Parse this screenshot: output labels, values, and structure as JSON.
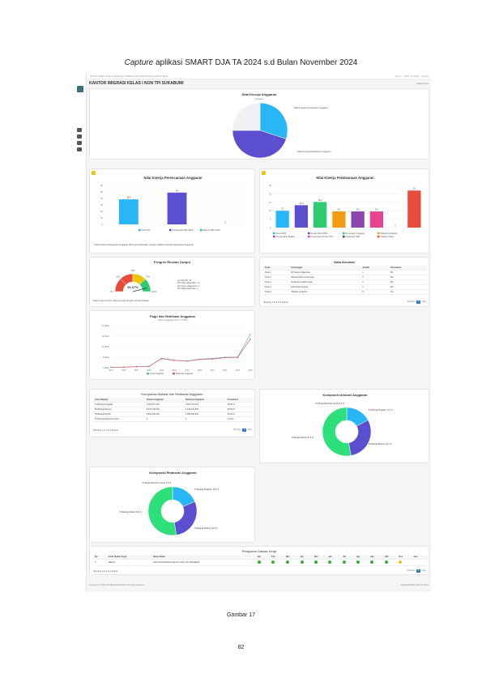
{
  "caption_top": {
    "italic": "Capture",
    "rest": " aplikasi SMART DJA TA 2024 s.d Bulan November 2024"
  },
  "caption_bottom": "Gambar 17",
  "page_number": "82",
  "app": {
    "topbar_title": "MONITORING DAN EVALUASI KINERJA PELAKSANAAN ANGGARAN",
    "topbar_right": [
      "Home",
      "TWIT TA 2024",
      "Logout"
    ],
    "office": "KANTOR IMIGRASI KELAS I NON TPI SUKABUMI",
    "breadcrumb": "Dashboard",
    "footer_left": "Copyright © 2024 DITJEN ANGGARAN. All rights reserved.",
    "footer_right": "Aplikasi SMART DJA TA 2024"
  },
  "nka_pie": {
    "title": "Nilai Kinerja Anggaran",
    "sub": "Capaian",
    "label_a": "Nilai Kinerja Perencanaan Anggaran",
    "label_b": "Nilai Kinerja Pelaksanaan Anggaran"
  },
  "chart_data": [
    {
      "type": "pie",
      "title": "Nilai Kinerja Anggaran",
      "slices": [
        {
          "name": "Nilai Kinerja Perencanaan Anggaran",
          "value": 30,
          "color": "#29b6f6"
        },
        {
          "name": "Nilai Kinerja Pelaksanaan Anggaran",
          "value": 45,
          "color": "#5b4fd0"
        },
        {
          "name": "",
          "value": 25,
          "color": "#f1f1f3"
        }
      ]
    },
    {
      "type": "bar",
      "title": "Nilai Kinerja Perencanaan Anggaran",
      "categories": [
        "IKPA",
        "Penggunaan",
        "Efisiensi"
      ],
      "values": [
        38.6,
        49,
        0
      ],
      "ylim": [
        0,
        60
      ],
      "colors": [
        "#29b6f6",
        "#5b4fd0",
        "#2ecc71"
      ],
      "labels": [
        "38.6",
        "49",
        "0"
      ],
      "legend": [
        "Nilai IKPA",
        "Penggunaan SBK (35%)",
        "Efisiensi SBK (25%)"
      ]
    },
    {
      "type": "bar",
      "title": "Nilai Kinerja Pelaksanaan Anggaran",
      "categories": [
        "a",
        "b",
        "c",
        "d",
        "e",
        "f",
        "g",
        "h"
      ],
      "values": [
        10,
        13.3,
        15.2,
        9.6,
        9.6,
        9.6,
        0,
        22
      ],
      "ylim": [
        0,
        25
      ],
      "colors": [
        "#29b6f6",
        "#5b4fd0",
        "#2ecc71",
        "#f39c12",
        "#8e44ad",
        "#e84393",
        "#34495e",
        "#e74c3c"
      ],
      "labels": [
        "10",
        "13.3",
        "15.2",
        "9.6",
        "9.6",
        "9.6",
        "0",
        "22"
      ],
      "legend": [
        "Revisi DIPA",
        "Deviasi Hal III DIPA",
        "Penyerapan Anggaran",
        "Belanja Kontraktual",
        "Penyelesaian Tagihan",
        "Pengelolaan UP dan TUP",
        "Dispensasi SPM",
        "Capaian Output"
      ]
    },
    {
      "type": "line",
      "title": "Pagu dan Realisasi Anggaran",
      "sub": "Tahun Anggaran 2017 s.d 2024",
      "x": [
        "2013",
        "2014",
        "2015",
        "2016",
        "2017",
        "2018",
        "2019",
        "2020",
        "2021",
        "2022",
        "2023",
        "2024"
      ],
      "series": [
        {
          "name": "Pagu Anggaran",
          "values": [
            0.2,
            0.3,
            0.5,
            0.6,
            4.5,
            3.6,
            3.2,
            4.1,
            4.4,
            5.0,
            5.1,
            15.8
          ]
        },
        {
          "name": "Realisasi Anggaran",
          "values": [
            0.2,
            0.3,
            0.5,
            0.6,
            4.3,
            3.5,
            3.1,
            3.9,
            4.1,
            4.8,
            4.9,
            13.6
          ]
        }
      ],
      "yticks": [
        "0 Miliar",
        "5 Miliar",
        "10 Miliar",
        "15 Miliar",
        "20 Miliar"
      ],
      "ylim": [
        0,
        20
      ]
    },
    {
      "type": "pie",
      "title": "Komposisi Alokasi Anggaran",
      "slices": [
        {
          "name": "51 Belanja Pegawai",
          "value": 17.0,
          "color": "#29b6f6"
        },
        {
          "name": "52 Belanja Barang",
          "value": 30.2,
          "color": "#5b4fd0"
        },
        {
          "name": "53 Belanja Modal",
          "value": 52.8,
          "color": "#2ee07a"
        },
        {
          "name": "57 Belanja Bantuan Sosial",
          "value": 0,
          "color": "#f39c12"
        }
      ]
    },
    {
      "type": "pie",
      "title": "Komposisi Realisasi Anggaran",
      "slices": [
        {
          "name": "51 Belanja Pegawai",
          "value": 18.6,
          "color": "#29b6f6"
        },
        {
          "name": "52 Belanja Barang",
          "value": 28.9,
          "color": "#5b4fd0"
        },
        {
          "name": "53 Belanja Modal",
          "value": 52.5,
          "color": "#2ee07a"
        },
        {
          "name": "57 Belanja Bantuan Sosial",
          "value": 0,
          "color": "#f39c12"
        }
      ]
    }
  ],
  "pie_labels": {
    "alokasi": [
      "51 Belanja Pegawai: 17.0 %",
      "52 Belanja Barang: 30.2 %",
      "53 Belanja Modal: 52.8 %",
      "57 Belanja Bantuan Sosial: 0.0 %"
    ],
    "realisasi": [
      "51 Belanja Pegawai: 18.6 %",
      "52 Belanja Barang: 28.9 %",
      "53 Belanja Modal: 52.5 %",
      "57 Belanja Bantuan Sosial: 0.0 %"
    ]
  },
  "bar1_note": "* Nilai Kinerja Pelaksanaan Anggaran dihitung berdasarkan capaian indikator kinerja pelaksanaan anggaran",
  "progres": {
    "title": "Progres Rincian Output",
    "value": "91.67%",
    "notes": [
      "Jumlah RO: 12",
      "RO telah dilaporkan: 11",
      "RO belum dilaporkan: 1",
      "RO tidak dilaporkan: 0"
    ],
    "footnote": "Data progres rincian output sampai dengan periode berjalan",
    "ticks": [
      "0%",
      "25%",
      "50%",
      "75%",
      "100%"
    ]
  },
  "anomali": {
    "title": "Data Anomali",
    "headers": [
      "Kode",
      "Keterangan",
      "Jumlah",
      "Persentase"
    ],
    "rows": [
      [
        "Kode 1",
        "RO belum dilaporkan",
        "1",
        "8%"
      ],
      [
        "Kode 2",
        "Belanja tidak sesuai akun",
        "0",
        "0%"
      ],
      [
        "Kode 3",
        "Realisasi melebihi pagu",
        "0",
        "0%"
      ],
      [
        "Kode 4",
        "Data tidak lengkap",
        "0",
        "0%"
      ],
      [
        "Kode 5",
        "Tagihan terlambat",
        "0",
        "0%"
      ]
    ],
    "footer": "Showing 1 to 5 of 5 entries",
    "prev": "Previous",
    "next": "Next",
    "page": "1"
  },
  "komparasi": {
    "title": "Komparasi Alokasi dan Realisasi Anggaran",
    "headers": [
      "Jenis Belanja",
      "Alokasi Anggaran",
      "Realisasi Anggaran",
      "Persentase"
    ],
    "rows": [
      [
        "51 Belanja Pegawai",
        "3.322.617.000",
        "2.842.031.279",
        "85.54 %"
      ],
      [
        "52 Belanja Barang",
        "5.478.448.000",
        "4.418.279.593",
        "80.65 %"
      ],
      [
        "53 Belanja Modal",
        "9.564.065.000",
        "7.968.498.200",
        "83.32 %"
      ],
      [
        "57 Belanja Bantuan Sosial",
        "0",
        "0",
        "0.00 %"
      ]
    ],
    "footer": "Showing 1 to 4 of 4 entries",
    "prev": "Previous",
    "next": "Next",
    "page": "1"
  },
  "pelaporan": {
    "title": "Pelaporan Satuan Kerja",
    "headers": [
      "No.",
      "Kode Satuan Kerja",
      "Nama Satker",
      "Jan",
      "Feb",
      "Mar",
      "Apr",
      "Mei",
      "Jun",
      "Jul",
      "Agt",
      "Sep",
      "Okt",
      "Nov",
      "Des"
    ],
    "row": [
      "1",
      "690123",
      "KANTOR IMIGRASI KELAS I NON TPI SUKABUMI"
    ],
    "footer": "Showing 1 to 1 of 1 entries",
    "prev": "Previous",
    "next": "Next",
    "page": "1"
  }
}
